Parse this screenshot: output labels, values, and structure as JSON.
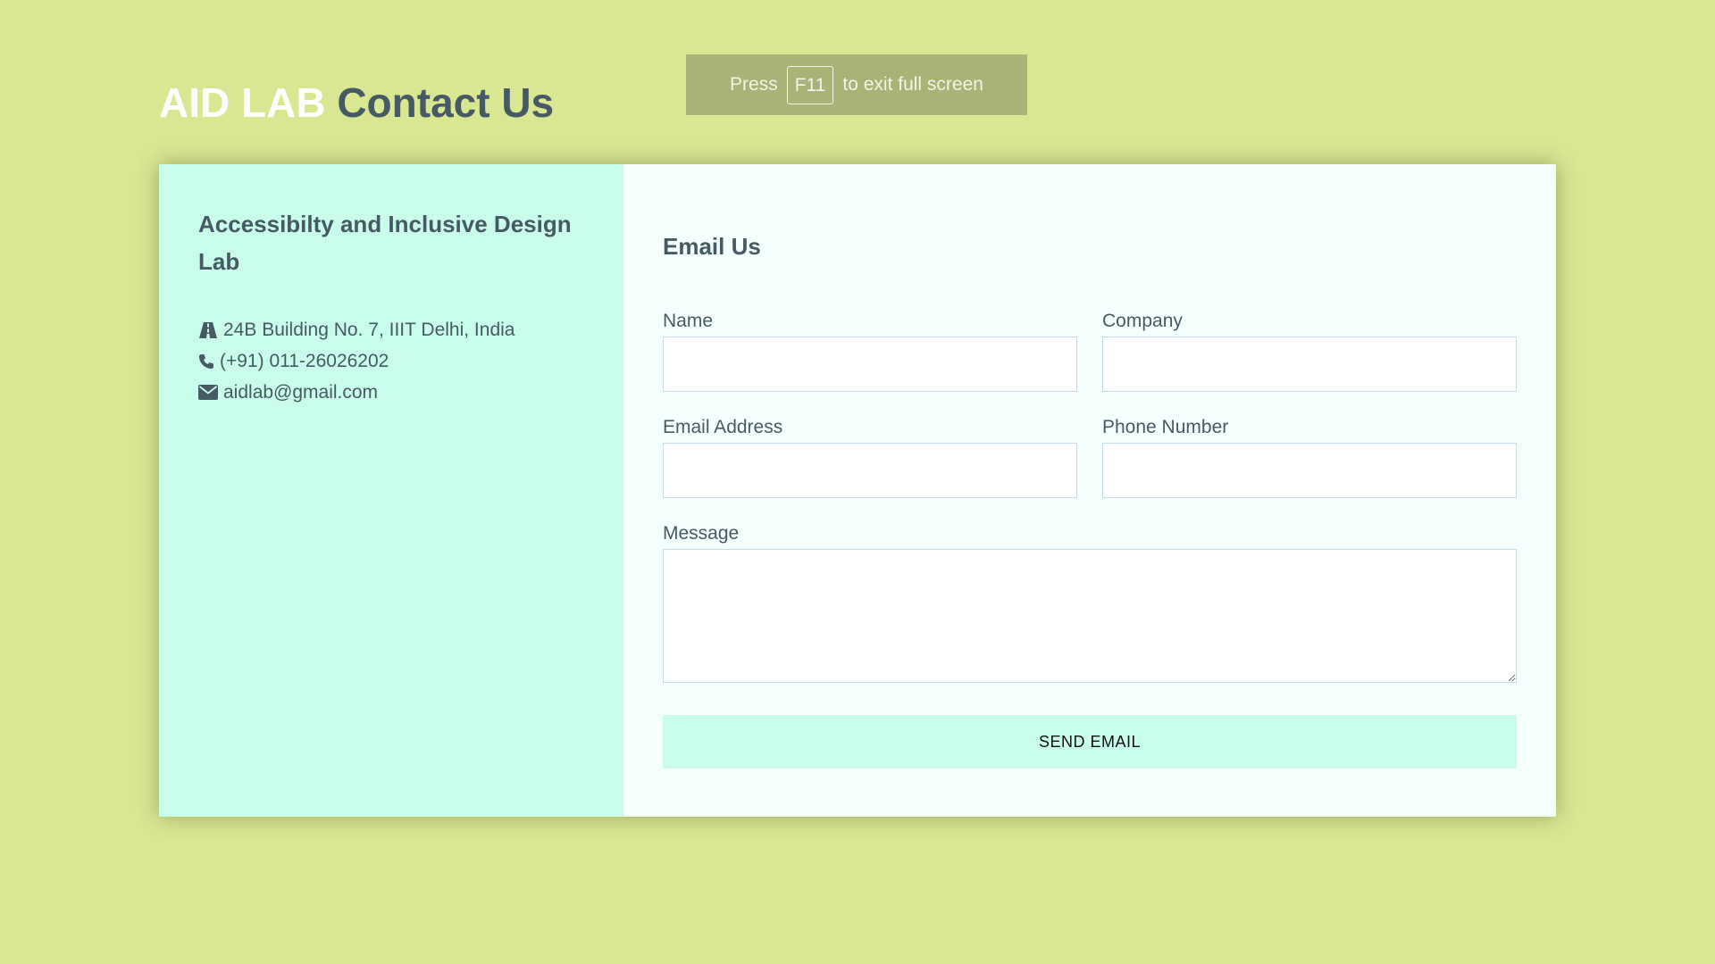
{
  "header": {
    "brand": "AID LAB",
    "title": "Contact Us"
  },
  "fullscreen_notice": {
    "before": "Press",
    "key": "F11",
    "after": "to exit full screen"
  },
  "info": {
    "lab_name": "Accessibilty and Inclusive Design Lab",
    "address": "24B Building No. 7, IIIT Delhi, India",
    "phone": "(+91) 011-26026202",
    "email": "aidlab@gmail.com",
    "icons": [
      "road-icon",
      "phone-icon",
      "envelope-icon"
    ]
  },
  "form": {
    "title": "Email Us",
    "name_label": "Name",
    "company_label": "Company",
    "email_label": "Email Address",
    "phone_label": "Phone Number",
    "message_label": "Message",
    "name_value": "",
    "company_value": "",
    "email_value": "",
    "phone_value": "",
    "message_value": "",
    "submit_label": "SEND EMAIL"
  },
  "colors": {
    "background": "#d9e692",
    "panel_left": "#c8fdec",
    "panel_right": "#f5fffd",
    "text": "#455a64",
    "brand": "#ffffff",
    "button": "#c8fdec"
  }
}
